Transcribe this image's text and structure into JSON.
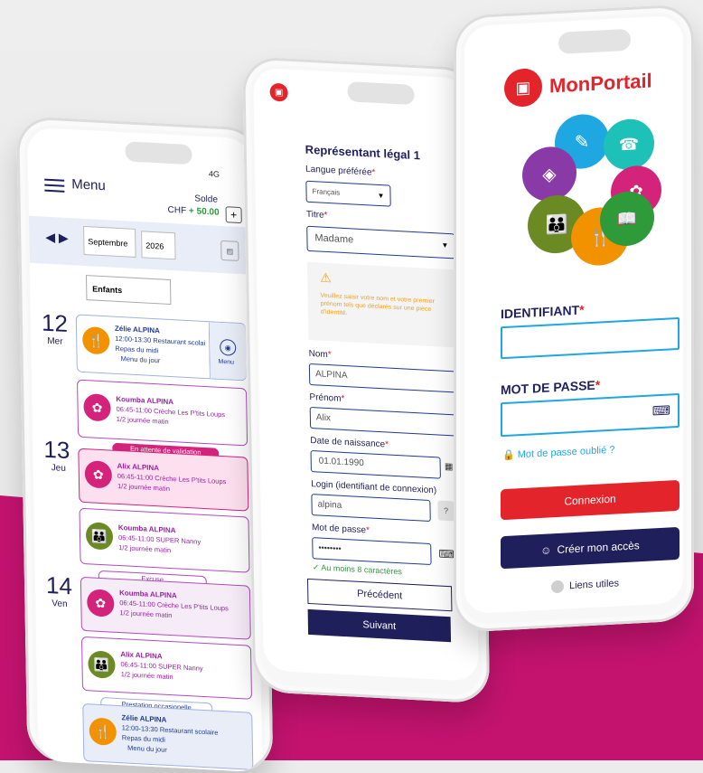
{
  "colors": {
    "magenta": "#c3136f",
    "navy": "#1f1f5c",
    "red": "#e3242b",
    "blue_label": "#1f3a93",
    "green": "#2e9a3a",
    "orange_warn": "#f5a01b"
  },
  "left_phone": {
    "menu_label": "Menu",
    "status": "4G",
    "solde_label": "Solde",
    "solde_currency": "CHF",
    "solde_value": "+ 50.00",
    "plus": "+",
    "month": "Septembre",
    "year": "2026",
    "filter": "Enfants",
    "days": [
      {
        "num": "12",
        "name": "Mer"
      },
      {
        "num": "13",
        "name": "Jeu"
      },
      {
        "num": "14",
        "name": "Ven"
      }
    ],
    "cards": [
      {
        "name": "Zélie ALPINA",
        "line1": "12:00-13:30 Restaurant scolaire",
        "line2": "Repas du midi",
        "line3": "Menu du jour",
        "side": "Menu"
      },
      {
        "name": "Koumba ALPINA",
        "line1": "06:45-11:00 Crèche Les P'tits Loups",
        "line2": "1/2 journée matin"
      },
      {
        "name": "Alix ALPINA",
        "line1": "06:45-11:00 Crèche Les P'tits Loups",
        "line2": "1/2 journée matin",
        "badge": "En attente de validation"
      },
      {
        "name": "Koumba ALPINA",
        "line1": "06:45-11:00 SUPER Nanny",
        "line2": "1/2 journée matin"
      },
      {
        "name": "Koumba ALPINA",
        "line1": "06:45-11:00 Crèche Les P'tits Loups",
        "line2": "1/2 journée matin",
        "badge": "Excuse"
      },
      {
        "name": "Alix ALPINA",
        "line1": "06:45-11:00 SUPER Nanny",
        "line2": "1/2 journée matin"
      },
      {
        "name": "Zélie ALPINA",
        "line1": "12:00-13:30 Restaurant scolaire",
        "line2": "Repas du midi",
        "line3": "Menu du jour",
        "badge": "Prestation occasionelle"
      }
    ]
  },
  "middle_phone": {
    "section_title": "Représentant légal 1",
    "lang_label": "Langue préférée",
    "lang_value": "Français",
    "titre_label": "Titre",
    "titre_value": "Madame",
    "warning": "Veuillez saisir votre nom et votre premier prénom tels que déclarés sur une pièce d'identité.",
    "nom_label": "Nom",
    "nom_value": "ALPINA",
    "prenom_label": "Prénom",
    "prenom_value": "Alix",
    "dob_label": "Date de naissance",
    "dob_value": "01.01.1990",
    "login_label": "Login (identifiant de connexion)",
    "login_value": "alpina",
    "help": "?",
    "pwd_label": "Mot de passe",
    "pwd_value": "••••••••",
    "pwd_hint": "Au moins 8 caractères",
    "prev_button": "Précédent",
    "next_button": "Suivant",
    "required_mark": "*"
  },
  "right_phone": {
    "app_name": "MonPortail",
    "id_label": "IDENTIFIANT",
    "pwd_label": "MOT DE PASSE",
    "required_mark": "*",
    "forgot": "Mot de passe oublié ?",
    "login_button": "Connexion",
    "create_button": "Créer mon accès",
    "links": "Liens utiles"
  }
}
